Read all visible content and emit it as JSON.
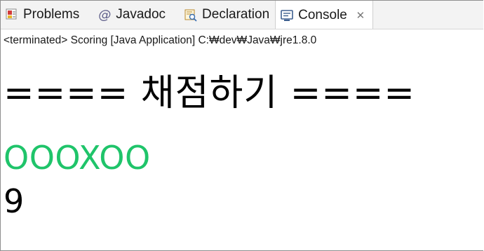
{
  "tabs": [
    {
      "label": "Problems",
      "icon": "problems-icon"
    },
    {
      "label": "Javadoc",
      "icon": "at-icon"
    },
    {
      "label": "Declaration",
      "icon": "declaration-icon"
    },
    {
      "label": "Console",
      "icon": "console-icon",
      "active": true,
      "close": "✕"
    }
  ],
  "status": "<terminated> Scoring [Java Application] C:₩dev₩Java₩jre1.8.0",
  "console": {
    "lines": [
      {
        "text": "====  채점하기 ====",
        "color": "#000000"
      },
      {
        "text": "OOOXOO",
        "color": "#1fc46a"
      },
      {
        "text": "9",
        "color": "#000000"
      }
    ]
  },
  "colors": {
    "tab_bar_bg": "#f3f3f3",
    "active_tab_bg": "#ffffff",
    "output_green": "#1fc46a"
  }
}
